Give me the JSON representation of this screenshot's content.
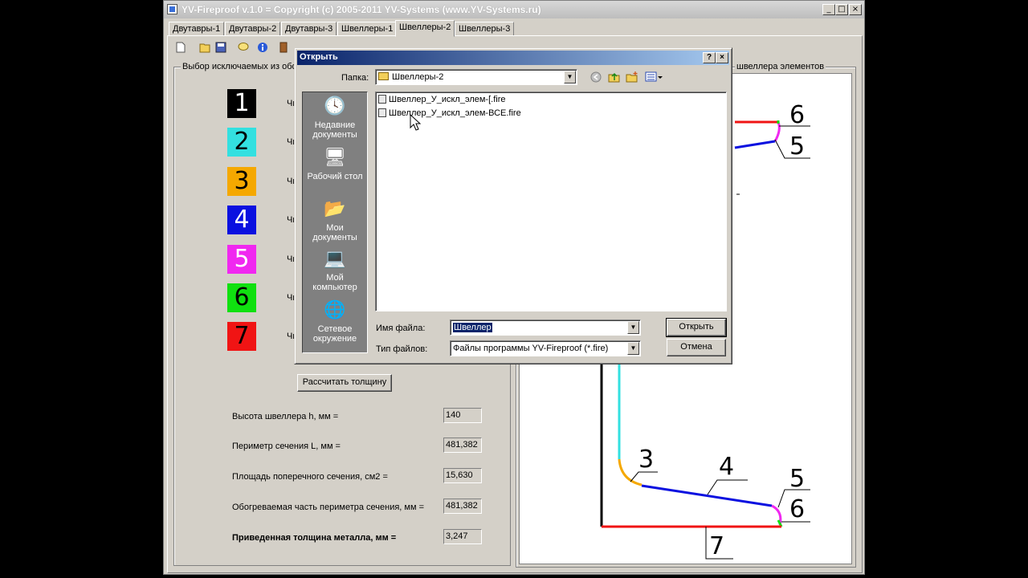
{
  "window": {
    "title": "YV-Fireproof v.1.0 = Copyright (c) 2005-2011 YV-Systems (www.YV-Systems.ru)",
    "minimize": "_",
    "maximize": "□",
    "close": "×"
  },
  "tabs": [
    {
      "label": "Двутавры-1"
    },
    {
      "label": "Двутавры-2"
    },
    {
      "label": "Двутавры-3"
    },
    {
      "label": "Швеллеры-1"
    },
    {
      "label": "Швеллеры-2",
      "active": true
    },
    {
      "label": "Швеллеры-3"
    }
  ],
  "left_group": {
    "legend": "Выбор исключаемых из обо",
    "rows": [
      {
        "number": "1",
        "label": "Чис",
        "color": "#000000",
        "text_color": "#ffffff"
      },
      {
        "number": "2",
        "label": "Чис",
        "color": "#33e0e0",
        "text_color": "#000000"
      },
      {
        "number": "3",
        "label": "Чис",
        "color": "#f5a800",
        "text_color": "#000000"
      },
      {
        "number": "4",
        "label": "Чис",
        "color": "#0a10e0",
        "text_color": "#ffffff"
      },
      {
        "number": "5",
        "label": "Чис",
        "color": "#f028f0",
        "text_color": "#ffffff"
      },
      {
        "number": "6",
        "label": "Чис",
        "color": "#10e010",
        "text_color": "#000000"
      },
      {
        "number": "7",
        "label": "Чис",
        "color": "#f01414",
        "text_color": "#000000"
      }
    ],
    "calc_button": "Рассчитать толщину",
    "params": [
      {
        "label": "Высота швеллера h, мм =",
        "value": "140"
      },
      {
        "label": "Периметр сечения L, мм =",
        "value": "481,382"
      },
      {
        "label": "Площадь поперечного сечения, см2 =",
        "value": "15,630"
      },
      {
        "label": "Обогреваемая часть периметра сечения, мм =",
        "value": "481,382"
      },
      {
        "label": "Приведенная толщина металла, мм =",
        "value": "3,247",
        "bold": true
      }
    ]
  },
  "right_group": {
    "legend": "швеллера элементов",
    "top_labels": [
      "6",
      "5"
    ],
    "bottom_labels": [
      "3",
      "4",
      "5",
      "6",
      "7"
    ]
  },
  "dialog": {
    "title": "Открыть",
    "help": "?",
    "close": "×",
    "folder_label": "Папка:",
    "folder_value": "Швеллеры-2",
    "places": [
      {
        "icon": "recent-documents-icon",
        "glyph": "🕓",
        "label": "Недавние документы"
      },
      {
        "icon": "desktop-icon",
        "glyph": "🖥",
        "label": "Рабочий стол"
      },
      {
        "icon": "my-documents-icon",
        "glyph": "📂",
        "label": "Мои документы"
      },
      {
        "icon": "my-computer-icon",
        "glyph": "💻",
        "label": "Мой компьютер"
      },
      {
        "icon": "network-icon",
        "glyph": "🌐",
        "label": "Сетевое окружение"
      }
    ],
    "files": [
      {
        "name": "Швеллер_У_искл_элем-[.fire"
      },
      {
        "name": "Швеллер_У_искл_элем-ВСЕ.fire"
      }
    ],
    "filename_label": "Имя файла:",
    "filename_value": "Швеллер",
    "filetype_label": "Тип файлов:",
    "filetype_value": "Файлы программы YV-Fireproof (*.fire)",
    "open_button": "Открыть",
    "cancel_button": "Отмена"
  }
}
